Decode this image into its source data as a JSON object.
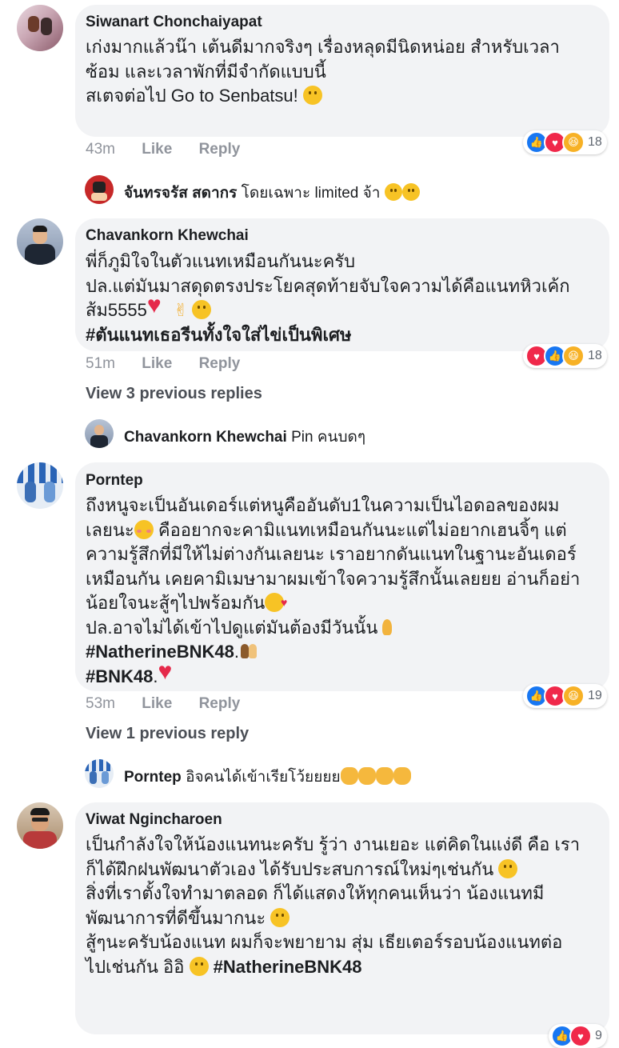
{
  "comments": [
    {
      "author": "Siwanart Chonchaiyapat",
      "lines": [
        "เก่งมากแล้วน๊า เต้นดีมากจริงๆ เรื่องหลุดมีนิดหน่อย สำหรับเวลา",
        "ซ้อม และเวลาพักที่มีจำกัดแบบนี้",
        "",
        "สเตจต่อไป Go to Senbatsu!"
      ],
      "time": "43m",
      "like_label": "Like",
      "reply_label": "Reply",
      "reaction_count": "18",
      "reply": {
        "author": "จันทรจรัส สดากร",
        "text": "โดยเฉพาะ limited จ้า"
      }
    },
    {
      "author": "Chavankorn Khewchai",
      "lines": [
        "พี่ก็ภูมิใจในตัวแนทเหมือนกันนะครับ",
        "ปล.แต่มันมาสดุดตรงประโยคสุดท้ายจับใจความได้คือแนทหิวเค้ก",
        "ส้ม5555"
      ],
      "hashtag": "#ตันแนทเธอรีนทั้งใจใส่ไข่เป็นพิเศษ",
      "time": "51m",
      "like_label": "Like",
      "reply_label": "Reply",
      "reaction_count": "18",
      "view_previous": "View 3 previous replies",
      "reply": {
        "author": "Chavankorn Khewchai",
        "text": "Pin คนบดๆ"
      }
    },
    {
      "author": "Porntep",
      "lines": [
        "ถึงหนูจะเป็นอันเดอร์แต่หนูคืออันดับ1ในความเป็นไอดอลของผม",
        "เลยนะ",
        " คืออยากจะคามิแนทเหมือนกันนะแต่ไม่อยากเฮนจิ้ๆ แต่",
        "ความรู้สึกที่มีให้ไม่ต่างกันเลยนะ เราอยากดันแนทในฐานะอันเดอร์",
        "เหมือนกัน เคยคามิเมษามาผมเข้าใจความรู้สึกนั้นเลยยย อ่านก็อย่า",
        "น้อยใจนะสู้ๆไปพร้อมกัน",
        "ปล.อาจไม่ได้เข้าไปดูแต่มันต้องมีวันนั้น"
      ],
      "hashtag1": "#NatherineBNK48",
      "hashtag2": "#BNK48",
      "time": "53m",
      "like_label": "Like",
      "reply_label": "Reply",
      "reaction_count": "19",
      "view_previous": "View 1 previous reply",
      "reply": {
        "author": "Porntep",
        "text": "อิจคนได้เข้าเรียโว้ยยยย"
      }
    },
    {
      "author": "Viwat Ngincharoen",
      "lines": [
        "เป็นกำลังใจให้น้องแนทนะครับ รู้ว่า งานเยอะ แต่คิดในแง่ดี คือ เรา",
        "ก็ได้ฝึกฝนพัฒนาตัวเอง ได้รับประสบการณ์ใหม่ๆเช่นกัน",
        "",
        "สิ่งที่เราตั้งใจทำมาตลอด ก็ได้แสดงให้ทุกคนเห็นว่า น้องแนทมี",
        "พัฒนาการที่ดีขึ้นมากนะ",
        "",
        "สู้ๆนะครับน้องแนท ผมก็จะพยายาม สุ่ม เธียเตอร์รอบน้องแนทต่อ",
        "ไปเช่นกัน อิอิ"
      ],
      "hashtag": "#NatherineBNK48",
      "reaction_count": "9"
    }
  ],
  "colors": {
    "bubble": "#f2f3f5",
    "like": "#1877f2",
    "love": "#f0284a",
    "haha": "#f7b125",
    "meta": "#90949c"
  }
}
